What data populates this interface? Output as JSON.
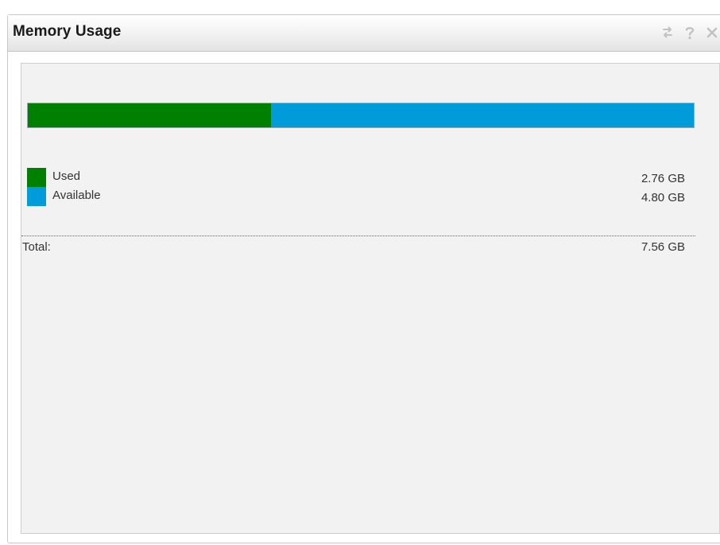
{
  "widget": {
    "title": "Memory Usage",
    "tools": [
      {
        "name": "refresh-icon",
        "glyph": "⇄"
      },
      {
        "name": "help-icon",
        "glyph": "?"
      },
      {
        "name": "close-icon",
        "glyph": "×"
      }
    ]
  },
  "memory": {
    "used_fraction": 0.365,
    "legend": [
      {
        "label": "Used",
        "value": "2.76 GB",
        "color": "#008000"
      },
      {
        "label": "Available",
        "value": "4.80 GB",
        "color": "#009cd9"
      }
    ],
    "total_label": "Total:",
    "total_value": "7.56 GB"
  }
}
